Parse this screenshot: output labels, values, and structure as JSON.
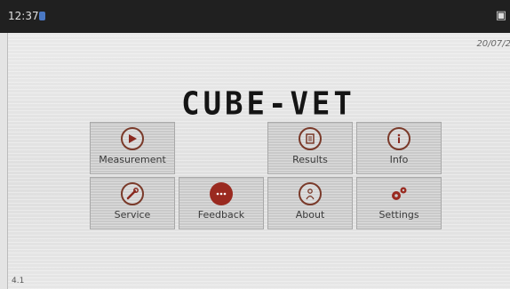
{
  "status_bar": {
    "time": "12:37",
    "notification_icon": "notification-icon",
    "vibrate_icon": "vibrate-icon"
  },
  "header": {
    "date": "20/07/2",
    "logo": "CUBE-VET"
  },
  "menu": [
    {
      "label": "Measurement",
      "icon": "play-icon"
    },
    {
      "label": "Results",
      "icon": "list-icon"
    },
    {
      "label": "Info",
      "icon": "info-icon"
    },
    {
      "label": "Service",
      "icon": "wrench-icon"
    },
    {
      "label": "Feedback",
      "icon": "chat-icon"
    },
    {
      "label": "About",
      "icon": "about-icon"
    },
    {
      "label": "Settings",
      "icon": "gears-icon"
    }
  ],
  "footer": {
    "version": "4.1"
  },
  "colors": {
    "accent": "#9a2a20",
    "status_bar": "#202020"
  }
}
